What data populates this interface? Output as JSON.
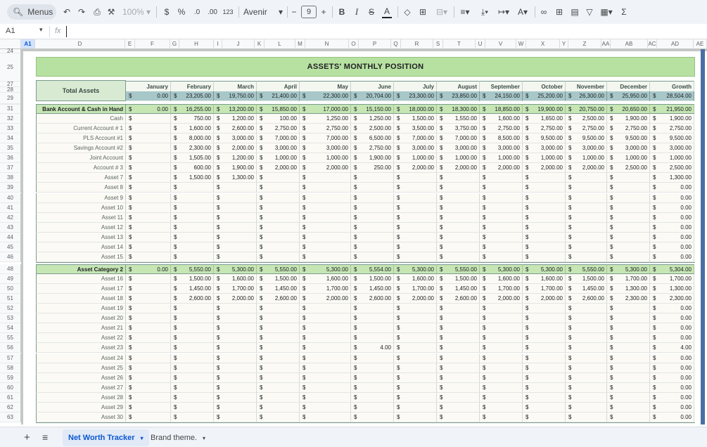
{
  "toolbar": {
    "menus_label": "Menus",
    "zoom": "100%",
    "currency": "$",
    "percent": "%",
    "dec_minus": ".0",
    "dec_plus": ".00",
    "format_123": "123",
    "font": "Avenir",
    "font_size": "9",
    "minus": "−",
    "plus": "+"
  },
  "formula_bar": {
    "cell_ref": "A1",
    "fx": "fx",
    "content": ""
  },
  "columns": [
    "A1",
    "D",
    "E",
    "F",
    "G",
    "H",
    "I",
    "J",
    "K",
    "L",
    "M",
    "N",
    "O",
    "P",
    "Q",
    "R",
    "S",
    "T",
    "U",
    "V",
    "W",
    "X",
    "Y",
    "Z",
    "AA",
    "AB",
    "AC",
    "AD",
    "AE"
  ],
  "sheet": {
    "title": "ASSETS' MONTHLY POSITION",
    "total_label": "Total Assets",
    "months": [
      "January",
      "February",
      "March",
      "April",
      "May",
      "June",
      "July",
      "August",
      "September",
      "October",
      "November",
      "December",
      "Growth"
    ],
    "currency_symbol": "$",
    "totals": [
      "0.00",
      "23,205.00",
      "19,750.00",
      "21,400.00",
      "22,300.00",
      "20,704.00",
      "23,300.00",
      "23,850.00",
      "24,150.00",
      "25,200.00",
      "26,300.00",
      "25,950.00",
      "28,504.00"
    ],
    "category1": {
      "name": "Bank Account & Cash in Hand",
      "values": [
        "0.00",
        "16,255.00",
        "13,200.00",
        "15,850.00",
        "17,000.00",
        "15,150.00",
        "18,000.00",
        "18,300.00",
        "18,850.00",
        "19,900.00",
        "20,750.00",
        "20,650.00",
        "21,950.00"
      ],
      "rows": [
        {
          "label": "Cash",
          "values": [
            "",
            "750.00",
            "1,200.00",
            "100.00",
            "1,250.00",
            "1,250.00",
            "1,500.00",
            "1,550.00",
            "1,600.00",
            "1,650.00",
            "2,500.00",
            "1,900.00",
            "1,900.00"
          ]
        },
        {
          "label": "Current Account # 1",
          "values": [
            "",
            "1,600.00",
            "2,600.00",
            "2,750.00",
            "2,750.00",
            "2,500.00",
            "3,500.00",
            "3,750.00",
            "2,750.00",
            "2,750.00",
            "2,750.00",
            "2,750.00",
            "2,750.00"
          ]
        },
        {
          "label": "PLS Account #1",
          "values": [
            "",
            "8,000.00",
            "3,000.00",
            "7,000.00",
            "7,000.00",
            "6,500.00",
            "7,000.00",
            "7,000.00",
            "8,500.00",
            "9,500.00",
            "9,500.00",
            "9,500.00",
            "9,500.00"
          ]
        },
        {
          "label": "Savings Account #2",
          "values": [
            "",
            "2,300.00",
            "2,000.00",
            "3,000.00",
            "3,000.00",
            "2,750.00",
            "3,000.00",
            "3,000.00",
            "3,000.00",
            "3,000.00",
            "3,000.00",
            "3,000.00",
            "3,000.00"
          ]
        },
        {
          "label": "Joint Account",
          "values": [
            "",
            "1,505.00",
            "1,200.00",
            "1,000.00",
            "1,000.00",
            "1,900.00",
            "1,000.00",
            "1,000.00",
            "1,000.00",
            "1,000.00",
            "1,000.00",
            "1,000.00",
            "1,000.00"
          ]
        },
        {
          "label": "Account # 3",
          "values": [
            "",
            "600.00",
            "1,900.00",
            "2,000.00",
            "2,000.00",
            "250.00",
            "2,000.00",
            "2,000.00",
            "2,000.00",
            "2,000.00",
            "2,000.00",
            "2,500.00",
            "2,500.00"
          ]
        },
        {
          "label": "Asset 7",
          "values": [
            "",
            "1,500.00",
            "1,300.00",
            "",
            "",
            "",
            "",
            "",
            "",
            "",
            "",
            "",
            "1,300.00"
          ]
        },
        {
          "label": "Asset 8",
          "values": [
            "",
            "",
            "",
            "",
            "",
            "",
            "",
            "",
            "",
            "",
            "",
            "",
            "0.00"
          ]
        },
        {
          "label": "Asset 9",
          "values": [
            "",
            "",
            "",
            "",
            "",
            "",
            "",
            "",
            "",
            "",
            "",
            "",
            "0.00"
          ]
        },
        {
          "label": "Asset 10",
          "values": [
            "",
            "",
            "",
            "",
            "",
            "",
            "",
            "",
            "",
            "",
            "",
            "",
            "0.00"
          ]
        },
        {
          "label": "Asset 11",
          "values": [
            "",
            "",
            "",
            "",
            "",
            "",
            "",
            "",
            "",
            "",
            "",
            "",
            "0.00"
          ]
        },
        {
          "label": "Asset 12",
          "values": [
            "",
            "",
            "",
            "",
            "",
            "",
            "",
            "",
            "",
            "",
            "",
            "",
            "0.00"
          ]
        },
        {
          "label": "Asset 13",
          "values": [
            "",
            "",
            "",
            "",
            "",
            "",
            "",
            "",
            "",
            "",
            "",
            "",
            "0.00"
          ]
        },
        {
          "label": "Asset 14",
          "values": [
            "",
            "",
            "",
            "",
            "",
            "",
            "",
            "",
            "",
            "",
            "",
            "",
            "0.00"
          ]
        },
        {
          "label": "Asset 15",
          "values": [
            "",
            "",
            "",
            "",
            "",
            "",
            "",
            "",
            "",
            "",
            "",
            "",
            "0.00"
          ]
        }
      ]
    },
    "category2": {
      "name": "Asset Category 2",
      "values": [
        "0.00",
        "5,550.00",
        "5,300.00",
        "5,550.00",
        "5,300.00",
        "5,554.00",
        "5,300.00",
        "5,550.00",
        "5,300.00",
        "5,300.00",
        "5,550.00",
        "5,300.00",
        "5,304.00"
      ],
      "rows": [
        {
          "label": "Asset 16",
          "values": [
            "",
            "1,500.00",
            "1,600.00",
            "1,500.00",
            "1,600.00",
            "1,500.00",
            "1,600.00",
            "1,500.00",
            "1,600.00",
            "1,600.00",
            "1,500.00",
            "1,700.00",
            "1,700.00"
          ]
        },
        {
          "label": "Asset 17",
          "values": [
            "",
            "1,450.00",
            "1,700.00",
            "1,450.00",
            "1,700.00",
            "1,450.00",
            "1,700.00",
            "1,450.00",
            "1,700.00",
            "1,700.00",
            "1,450.00",
            "1,300.00",
            "1,300.00"
          ]
        },
        {
          "label": "Asset 18",
          "values": [
            "",
            "2,600.00",
            "2,000.00",
            "2,600.00",
            "2,000.00",
            "2,600.00",
            "2,000.00",
            "2,600.00",
            "2,000.00",
            "2,000.00",
            "2,600.00",
            "2,300.00",
            "2,300.00"
          ]
        },
        {
          "label": "Asset 19",
          "values": [
            "",
            "",
            "",
            "",
            "",
            "",
            "",
            "",
            "",
            "",
            "",
            "",
            "0.00"
          ]
        },
        {
          "label": "Asset 20",
          "values": [
            "",
            "",
            "",
            "",
            "",
            "",
            "",
            "",
            "",
            "",
            "",
            "",
            "0.00"
          ]
        },
        {
          "label": "Asset 21",
          "values": [
            "",
            "",
            "",
            "",
            "",
            "",
            "",
            "",
            "",
            "",
            "",
            "",
            "0.00"
          ]
        },
        {
          "label": "Asset 22",
          "values": [
            "",
            "",
            "",
            "",
            "",
            "",
            "",
            "",
            "",
            "",
            "",
            "",
            "0.00"
          ]
        },
        {
          "label": "Asset 23",
          "values": [
            "",
            "",
            "",
            "",
            "",
            "4.00",
            "",
            "",
            "",
            "",
            "",
            "",
            "4.00"
          ]
        },
        {
          "label": "Asset 24",
          "values": [
            "",
            "",
            "",
            "",
            "",
            "",
            "",
            "",
            "",
            "",
            "",
            "",
            "0.00"
          ]
        },
        {
          "label": "Asset 25",
          "values": [
            "",
            "",
            "",
            "",
            "",
            "",
            "",
            "",
            "",
            "",
            "",
            "",
            "0.00"
          ]
        },
        {
          "label": "Asset 26",
          "values": [
            "",
            "",
            "",
            "",
            "",
            "",
            "",
            "",
            "",
            "",
            "",
            "",
            "0.00"
          ]
        },
        {
          "label": "Asset 27",
          "values": [
            "",
            "",
            "",
            "",
            "",
            "",
            "",
            "",
            "",
            "",
            "",
            "",
            "0.00"
          ]
        },
        {
          "label": "Asset 28",
          "values": [
            "",
            "",
            "",
            "",
            "",
            "",
            "",
            "",
            "",
            "",
            "",
            "",
            "0.00"
          ]
        },
        {
          "label": "Asset 29",
          "values": [
            "",
            "",
            "",
            "",
            "",
            "",
            "",
            "",
            "",
            "",
            "",
            "",
            "0.00"
          ]
        },
        {
          "label": "Asset 30",
          "values": [
            "",
            "",
            "",
            "",
            "",
            "",
            "",
            "",
            "",
            "",
            "",
            "",
            "0.00"
          ]
        }
      ]
    }
  },
  "row_numbers": {
    "frozen": [
      "24",
      "25",
      "27",
      "28",
      "29"
    ],
    "cat1": [
      "31",
      "32",
      "33",
      "34",
      "35",
      "36",
      "37",
      "38",
      "39",
      "40",
      "41",
      "42",
      "43",
      "44",
      "45",
      "46"
    ],
    "cat2": [
      "48",
      "49",
      "50",
      "51",
      "52",
      "53",
      "54",
      "55",
      "56",
      "57",
      "58",
      "59",
      "60",
      "61",
      "62",
      "63"
    ]
  },
  "tabs": [
    {
      "label": "Net Worth Tracker",
      "active": true
    },
    {
      "label": "Brand theme.",
      "active": false
    }
  ],
  "colors": {
    "title_bg": "#b7e1a1",
    "total_label_bg": "#d9ead3",
    "total_row_bg": "#a7c7c9",
    "category_bg": "#c6e6b4",
    "row_bg": "#fbfaf5",
    "border": "#7a9b8e",
    "accent": "#0b57d0"
  }
}
